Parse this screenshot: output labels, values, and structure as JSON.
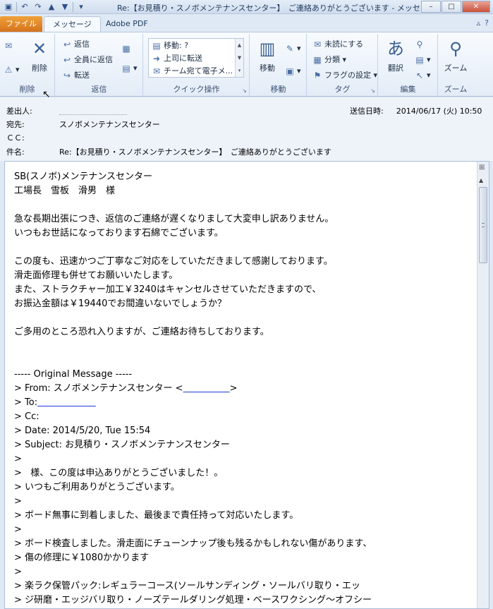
{
  "window": {
    "title": "Re:【お見積り・スノボメンテナンスセンター】　ご連絡ありがとうございます  -  メッセージ...",
    "controls": [
      "–",
      "□",
      "✕"
    ]
  },
  "qat": {
    "icons": [
      "save-icon",
      "undo-icon",
      "redo-icon",
      "up-arrow-icon",
      "down-arrow-icon",
      "customize-icon"
    ]
  },
  "tabs": [
    {
      "label": "ファイル"
    },
    {
      "label": "メッセージ"
    },
    {
      "label": "Adobe PDF"
    }
  ],
  "ribbon": {
    "delete_group": {
      "label": "削除",
      "delete_label": "削除"
    },
    "reply_group": {
      "label": "返信",
      "reply": "返信",
      "reply_all": "全員に返信",
      "forward": "転送"
    },
    "quick_group": {
      "label": "クイック操作",
      "items": [
        "移動: ?",
        "上司に転送",
        "チーム宛て電子メ..."
      ]
    },
    "move_group": {
      "label": "移動",
      "move_label": "移動"
    },
    "tag_group": {
      "label": "タグ",
      "unread": "未読にする",
      "categorize": "分類",
      "follow_up": "フラグの設定"
    },
    "edit_group": {
      "label": "編集",
      "translate": "翻訳"
    },
    "zoom_group": {
      "label": "ズーム",
      "zoom_label": "ズーム"
    }
  },
  "header": {
    "from_label": "差出人:",
    "to_label": "宛先:",
    "to_value": "スノボメンテナンスセンター",
    "cc_label": "ＣＣ:",
    "subject_label": "件名:",
    "subject_value": "Re:【お見積り・スノボメンテナンスセンター】　ご連絡ありがとうございます",
    "sent_label": "送信日時:",
    "sent_value": "2014/06/17 (火) 10:50"
  },
  "body": {
    "lines": [
      "SB(スノボ)メンテナンスセンター",
      "工場長　雪板　滑男　様",
      "",
      "急な長期出張につき、返信のご連絡が遅くなりまして大変申し訳ありません。",
      "いつもお世話になっております石綿でございます。",
      "",
      "この度も、迅速かつご丁寧なご対応をしていただきまして感謝しております。",
      "滑走面修理も併せてお願いいたします。",
      "また、ストラクチャー加工￥3240はキャンセルさせていただきますので、",
      "お振込金額は￥19440でお間違いないでしょうか？",
      "",
      "ご多用のところ恐れ入りますが、ご連絡お待ちしております。",
      "",
      "",
      "----- Original Message -----",
      "> From: スノボメンテナンスセンター <",
      "> To:",
      "> Cc:",
      "> Date: 2014/5/20, Tue 15:54",
      "> Subject: お見積り・スノボメンテナンスセンター",
      ">",
      ">   様、この度は申込ありがとうございました！。",
      "> いつもご利用ありがとうございます。",
      ">",
      "> ボード無事に到着しました、最後まで責任持って対応いたします。",
      ">",
      "> ボード検査しました。滑走面にチューンナップ後も残るかもしれない傷があります、",
      "> 傷の修理に￥1080かかります",
      ">",
      "> 楽ラク保管パック:レギュラーコース(ソールサンディング・ソールバリ取り・エッ",
      "> ジ研磨・エッジバリ取り・ノーズテールダリング処理・ベースワクシング～オフシー"
    ],
    "from_suffix": ">"
  }
}
